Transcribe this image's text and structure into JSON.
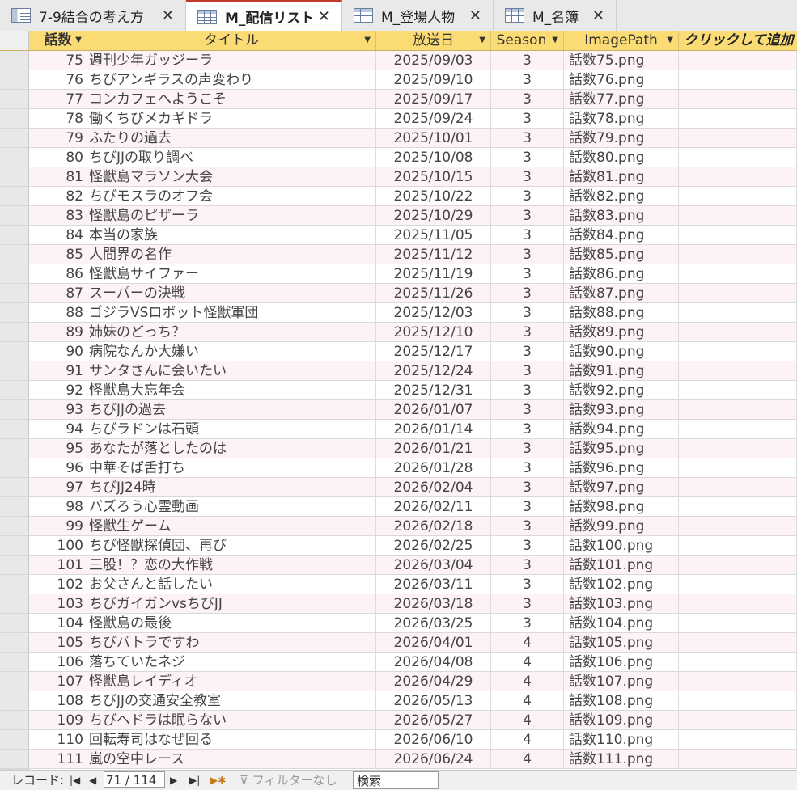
{
  "tabs": [
    {
      "label": "7-9結合の考え方",
      "icon": "query-icon",
      "active": false
    },
    {
      "label": "M_配信リスト",
      "icon": "table-icon",
      "active": true
    },
    {
      "label": "M_登場人物",
      "icon": "table-icon",
      "active": false
    },
    {
      "label": "M_名簿",
      "icon": "table-icon",
      "active": false
    }
  ],
  "tab_close_glyph": "✕",
  "columns": {
    "episode": "話数",
    "title": "タイトル",
    "air_date": "放送日",
    "season": "Season",
    "image_path": "ImagePath",
    "add_field": "クリックして追加"
  },
  "rows": [
    [
      "75",
      "週刊少年ガッジーラ",
      "2025/09/03",
      "3",
      "話数75.png"
    ],
    [
      "76",
      "ちびアンギラスの声変わり",
      "2025/09/10",
      "3",
      "話数76.png"
    ],
    [
      "77",
      "コンカフェへようこそ",
      "2025/09/17",
      "3",
      "話数77.png"
    ],
    [
      "78",
      "働くちびメカギドラ",
      "2025/09/24",
      "3",
      "話数78.png"
    ],
    [
      "79",
      "ふたりの過去",
      "2025/10/01",
      "3",
      "話数79.png"
    ],
    [
      "80",
      "ちびJJの取り調べ",
      "2025/10/08",
      "3",
      "話数80.png"
    ],
    [
      "81",
      "怪獣島マラソン大会",
      "2025/10/15",
      "3",
      "話数81.png"
    ],
    [
      "82",
      "ちびモスラのオフ会",
      "2025/10/22",
      "3",
      "話数82.png"
    ],
    [
      "83",
      "怪獣島のピザーラ",
      "2025/10/29",
      "3",
      "話数83.png"
    ],
    [
      "84",
      "本当の家族",
      "2025/11/05",
      "3",
      "話数84.png"
    ],
    [
      "85",
      "人間界の名作",
      "2025/11/12",
      "3",
      "話数85.png"
    ],
    [
      "86",
      "怪獣島サイファー",
      "2025/11/19",
      "3",
      "話数86.png"
    ],
    [
      "87",
      "スーパーの決戦",
      "2025/11/26",
      "3",
      "話数87.png"
    ],
    [
      "88",
      "ゴジラVSロボット怪獣軍団",
      "2025/12/03",
      "3",
      "話数88.png"
    ],
    [
      "89",
      "姉妹のどっち？",
      "2025/12/10",
      "3",
      "話数89.png"
    ],
    [
      "90",
      "病院なんか大嫌い",
      "2025/12/17",
      "3",
      "話数90.png"
    ],
    [
      "91",
      "サンタさんに会いたい",
      "2025/12/24",
      "3",
      "話数91.png"
    ],
    [
      "92",
      "怪獣島大忘年会",
      "2025/12/31",
      "3",
      "話数92.png"
    ],
    [
      "93",
      "ちびJJの過去",
      "2026/01/07",
      "3",
      "話数93.png"
    ],
    [
      "94",
      "ちびラドンは石頭",
      "2026/01/14",
      "3",
      "話数94.png"
    ],
    [
      "95",
      "あなたが落としたのは",
      "2026/01/21",
      "3",
      "話数95.png"
    ],
    [
      "96",
      "中華そば舌打ち",
      "2026/01/28",
      "3",
      "話数96.png"
    ],
    [
      "97",
      "ちびJJ24時",
      "2026/02/04",
      "3",
      "話数97.png"
    ],
    [
      "98",
      "バズろう心霊動画",
      "2026/02/11",
      "3",
      "話数98.png"
    ],
    [
      "99",
      "怪獣生ゲーム",
      "2026/02/18",
      "3",
      "話数99.png"
    ],
    [
      "100",
      "ちび怪獣探偵団、再び",
      "2026/02/25",
      "3",
      "話数100.png"
    ],
    [
      "101",
      "三股！？恋の大作戦",
      "2026/03/04",
      "3",
      "話数101.png"
    ],
    [
      "102",
      "お父さんと話したい",
      "2026/03/11",
      "3",
      "話数102.png"
    ],
    [
      "103",
      "ちびガイガンvsちびJJ",
      "2026/03/18",
      "3",
      "話数103.png"
    ],
    [
      "104",
      "怪獣島の最後",
      "2026/03/25",
      "3",
      "話数104.png"
    ],
    [
      "105",
      "ちびバトラですわ",
      "2026/04/01",
      "4",
      "話数105.png"
    ],
    [
      "106",
      "落ちていたネジ",
      "2026/04/08",
      "4",
      "話数106.png"
    ],
    [
      "107",
      "怪獣島レイディオ",
      "2026/04/29",
      "4",
      "話数107.png"
    ],
    [
      "108",
      "ちびJJの交通安全教室",
      "2026/05/13",
      "4",
      "話数108.png"
    ],
    [
      "109",
      "ちびヘドラは眠らない",
      "2026/05/27",
      "4",
      "話数109.png"
    ],
    [
      "110",
      "回転寿司はなぜ回る",
      "2026/06/10",
      "4",
      "話数110.png"
    ],
    [
      "111",
      "嵐の空中レース",
      "2026/06/24",
      "4",
      "話数111.png"
    ]
  ],
  "statusbar": {
    "record_label": "レコード:",
    "record_value": "71 / 114",
    "filter_label": "フィルターなし",
    "search_placeholder": "検索",
    "nav_first": "|◀",
    "nav_prev": "◀",
    "nav_next": "▶",
    "nav_last": "▶|",
    "nav_new": "▶✱"
  }
}
